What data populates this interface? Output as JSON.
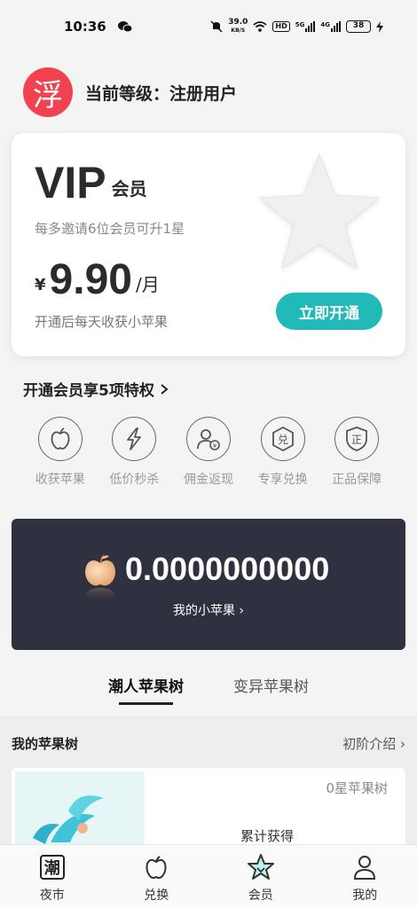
{
  "status_bar": {
    "time": "10:36",
    "net_speed": "39.0",
    "net_unit": "KB/S",
    "hd": "HD",
    "sig1": "5G",
    "sig2": "4G",
    "battery": "38"
  },
  "user": {
    "avatar_char": "浮",
    "level_text": "当前等级：注册用户"
  },
  "vip_card": {
    "title_big": "VIP",
    "title_small": "会员",
    "subtitle": "每多邀请6位会员可升1星",
    "price_symbol": "¥",
    "price": "9.90",
    "price_unit": "/月",
    "note": "开通后每天收获小苹果",
    "open_button": "立即开通"
  },
  "privileges": {
    "title": "开通会员享5项特权",
    "items": [
      {
        "label": "收获苹果",
        "icon": "apple-icon"
      },
      {
        "label": "低价秒杀",
        "icon": "lightning-icon"
      },
      {
        "label": "佣金返现",
        "icon": "cashback-user-icon"
      },
      {
        "label": "专享兑换",
        "icon": "exchange-badge-icon"
      },
      {
        "label": "正品保障",
        "icon": "shield-genuine-icon"
      }
    ],
    "icon_chars": {
      "exchange": "兑",
      "genuine": "正"
    }
  },
  "apples": {
    "value": "0.0000000000",
    "label": "我的小苹果 ›"
  },
  "tabs": [
    {
      "label": "潮人苹果树",
      "active": true
    },
    {
      "label": "变异苹果树",
      "active": false
    }
  ],
  "tree": {
    "heading": "我的苹果树",
    "intro_link": "初阶介绍 ›",
    "stars_text": "0星苹果树",
    "earned_label": "累计获得"
  },
  "bottom_nav": [
    {
      "label": "夜市",
      "icon": "chao-icon",
      "char": "潮"
    },
    {
      "label": "兑换",
      "icon": "apple-outline-icon"
    },
    {
      "label": "会员",
      "icon": "star-member-icon"
    },
    {
      "label": "我的",
      "icon": "person-icon"
    }
  ],
  "colors": {
    "accent": "#22b9b9",
    "avatar_bg": "#f0424f",
    "dark_card": "#2f3040"
  }
}
